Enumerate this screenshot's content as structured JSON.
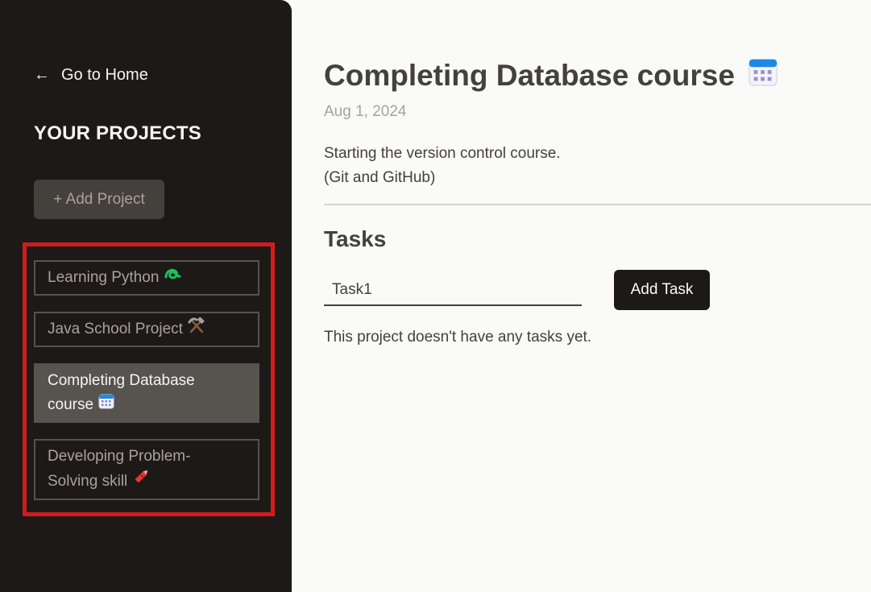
{
  "sidebar": {
    "home_link": {
      "arrow": "←",
      "label": "Go to Home"
    },
    "title": "YOUR PROJECTS",
    "add_project_label": "+ Add Project",
    "projects": [
      {
        "line1": "Learning Python",
        "line2": "",
        "icon": "loop-icon"
      },
      {
        "line1": "Java School Project",
        "line2": "",
        "icon": "hammer-pick-icon"
      },
      {
        "line1": "Completing Database",
        "line2": "course",
        "icon": "calendar-icon",
        "active": true
      },
      {
        "line1": "Developing Problem-",
        "line2": "Solving skill",
        "icon": "crayon-icon"
      }
    ]
  },
  "main": {
    "title": "Completing Database course",
    "title_icon": "calendar-icon",
    "date": "Aug 1, 2024",
    "description_line1": "Starting the version control course.",
    "description_line2": "(Git and GitHub)",
    "tasks_title": "Tasks",
    "task_input_value": "Task1",
    "add_task_label": "Add Task",
    "empty_message": "This project doesn't have any tasks yet."
  },
  "colors": {
    "sidebar_bg": "#1c1917",
    "active_item_bg": "#57534e",
    "highlight_border": "#d31b1b",
    "add_task_bg": "#1c1917"
  }
}
